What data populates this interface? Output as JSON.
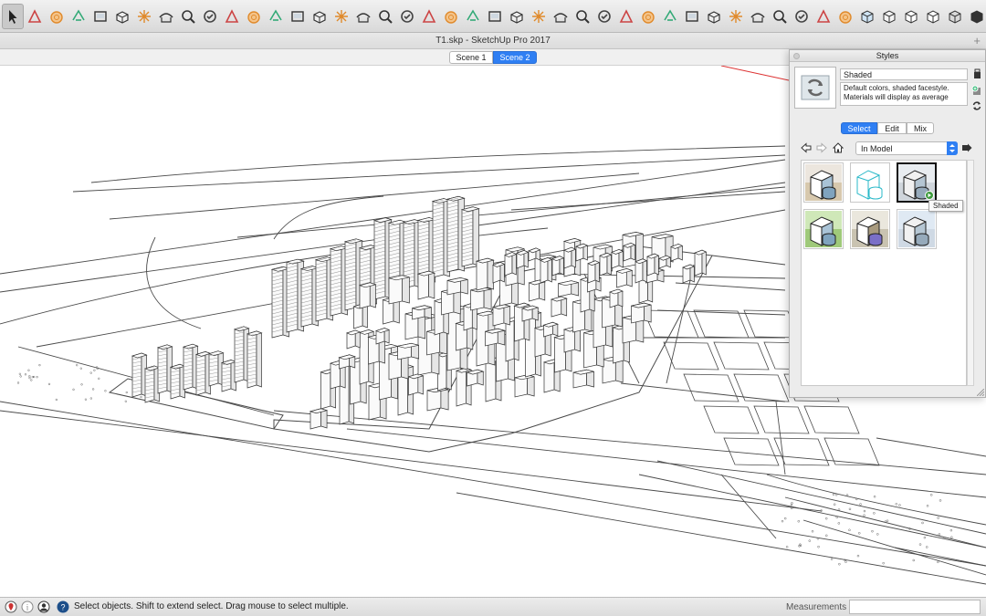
{
  "window": {
    "title": "T1.skp - SketchUp Pro 2017"
  },
  "scenes": [
    {
      "label": "Scene 1",
      "active": false
    },
    {
      "label": "Scene 2",
      "active": true
    }
  ],
  "toolbar": {
    "tools": [
      "select-arrow",
      "paint-bucket",
      "eraser",
      "pan",
      "paint",
      "layer",
      "tape",
      "dimension",
      "axes",
      "protractor",
      "push-pull",
      "follow-me",
      "offset",
      "move",
      "rotate",
      "scale",
      "arc",
      "circle",
      "polygon",
      "section-plane",
      "3d-text",
      "walk",
      "position-camera",
      "look-around",
      "zoom",
      "zoom-extents",
      "orbit",
      "sandbox",
      "solid-tools",
      "components",
      "materials",
      "styles",
      "fog",
      "shadows",
      "iso-view",
      "top-view",
      "front-view",
      "right-view",
      "back-view",
      "left-view",
      "x-ray",
      "back-edges",
      "wireframe",
      "hidden-line",
      "shaded",
      "shaded-textures",
      "monochrome"
    ]
  },
  "status": {
    "text": "Select objects. Shift to extend select. Drag mouse to select multiple.",
    "measurements_label": "Measurements",
    "measurements_value": ""
  },
  "styles_panel": {
    "title": "Styles",
    "style_name": "Shaded",
    "description_line1": "Default colors, shaded facestyle.",
    "description_line2": "Materials will display as average",
    "tabs": [
      "Select",
      "Edit",
      "Mix"
    ],
    "active_tab": "Select",
    "collection": "In Model",
    "thumbnails": [
      {
        "name": "shaded-with-textures",
        "selected": false
      },
      {
        "name": "hidden-line",
        "selected": false
      },
      {
        "name": "shaded",
        "selected": true
      },
      {
        "name": "green-sky",
        "selected": false
      },
      {
        "name": "purple-style",
        "selected": false
      },
      {
        "name": "blue-style",
        "selected": false
      }
    ],
    "tooltip": "Shaded"
  },
  "colors": {
    "accent": "#2f7ff3",
    "line": "#555555"
  }
}
